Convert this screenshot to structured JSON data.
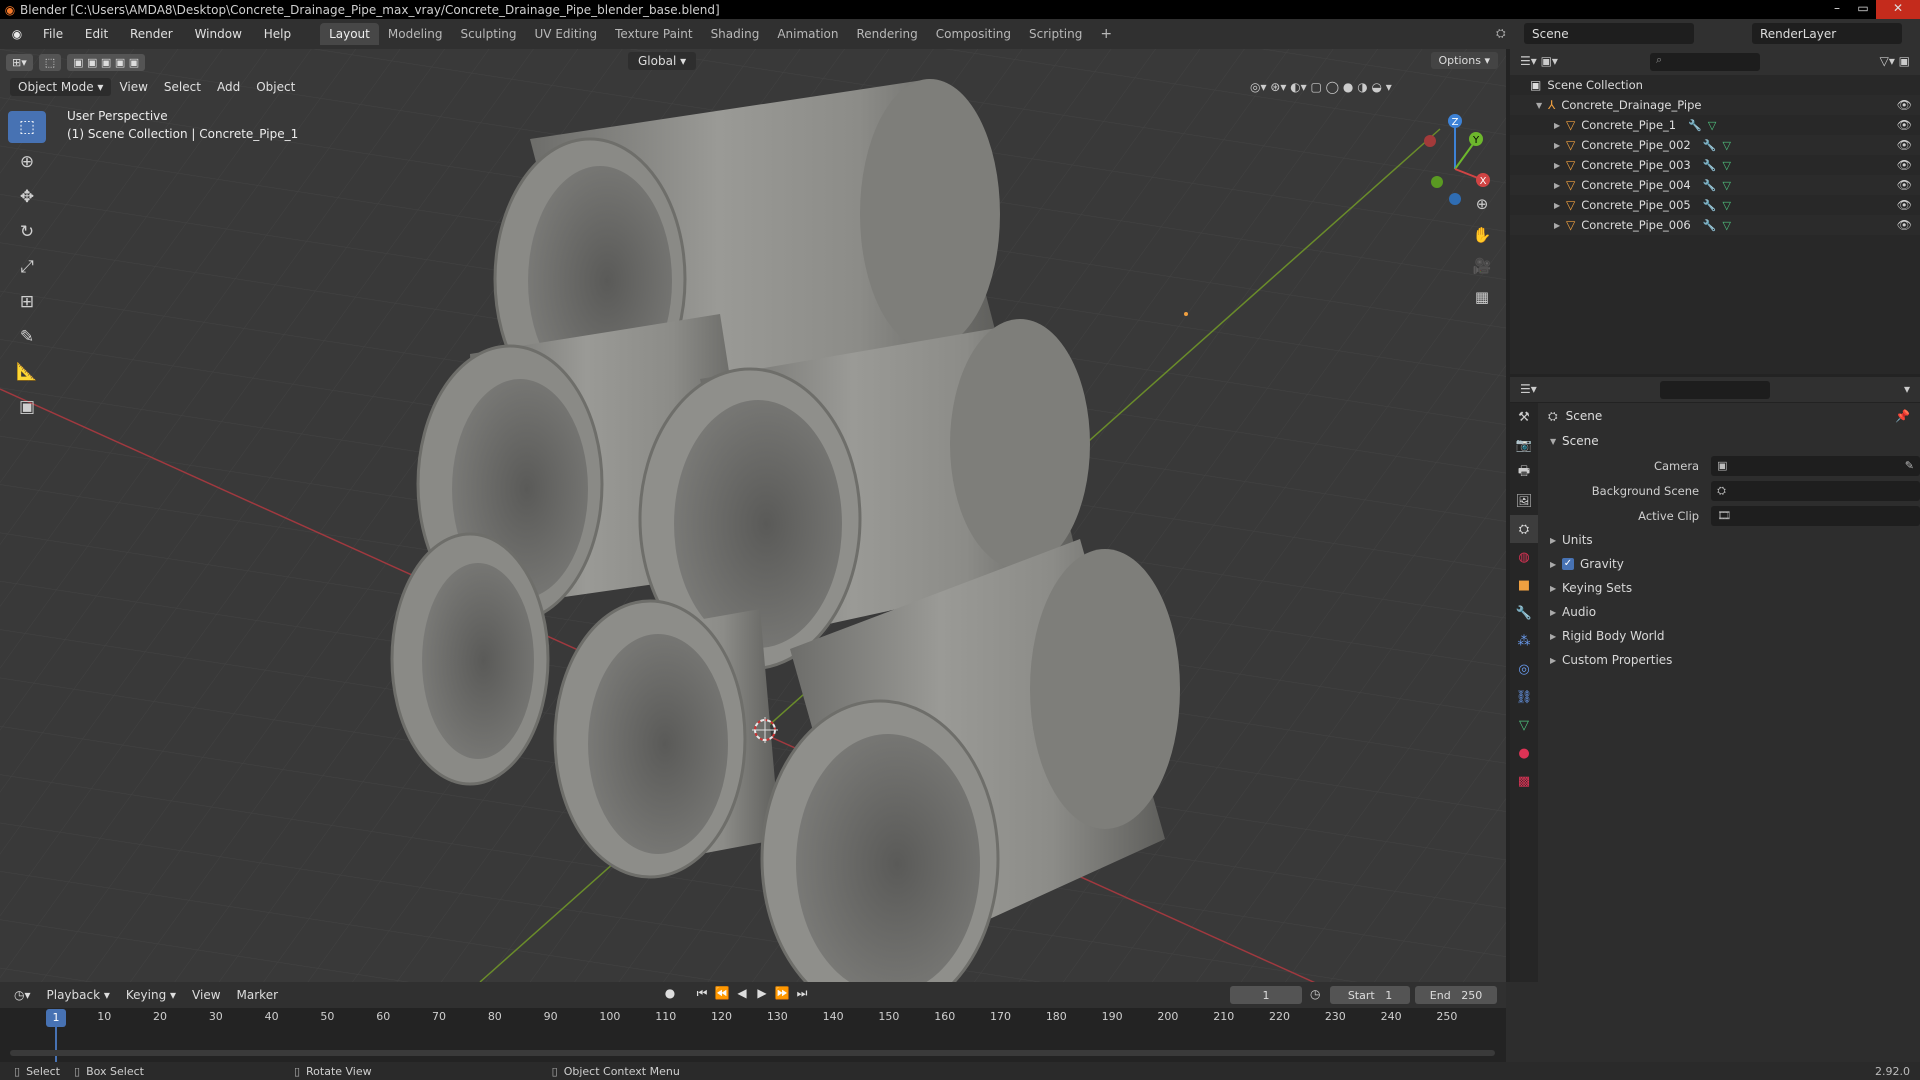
{
  "window": {
    "title": "Blender [C:\\Users\\AMDA8\\Desktop\\Concrete_Drainage_Pipe_max_vray/Concrete_Drainage_Pipe_blender_base.blend]"
  },
  "menu": [
    "File",
    "Edit",
    "Render",
    "Window",
    "Help"
  ],
  "workspaces": [
    "Layout",
    "Modeling",
    "Sculpting",
    "UV Editing",
    "Texture Paint",
    "Shading",
    "Animation",
    "Rendering",
    "Compositing",
    "Scripting"
  ],
  "active_workspace": "Layout",
  "scene_name": "Scene",
  "render_layer": "RenderLayer",
  "viewport": {
    "mode": "Object Mode",
    "menus": [
      "View",
      "Select",
      "Add",
      "Object"
    ],
    "orientation": "Global",
    "options_label": "Options",
    "perspective_label": "User Perspective",
    "collection_label": "(1) Scene Collection | Concrete_Pipe_1",
    "gizmo": {
      "z": "Z",
      "y": "Y",
      "x": "X"
    }
  },
  "outliner": {
    "root": "Scene Collection",
    "collection": "Concrete_Drainage_Pipe",
    "objects": [
      "Concrete_Pipe_1",
      "Concrete_Pipe_002",
      "Concrete_Pipe_003",
      "Concrete_Pipe_004",
      "Concrete_Pipe_005",
      "Concrete_Pipe_006"
    ]
  },
  "properties": {
    "header": "Scene",
    "panel": "Scene",
    "fields": {
      "camera": "Camera",
      "background_scene": "Background Scene",
      "active_clip": "Active Clip"
    },
    "collapsed": {
      "units": "Units",
      "gravity": "Gravity",
      "keying_sets": "Keying Sets",
      "audio": "Audio",
      "rigid_body_world": "Rigid Body World",
      "custom_properties": "Custom Properties"
    },
    "gravity_checked": true
  },
  "timeline": {
    "menus": [
      "Playback",
      "Keying",
      "View",
      "Marker"
    ],
    "current_frame": "1",
    "start_label": "Start",
    "start": "1",
    "end_label": "End",
    "end": "250",
    "ticks": [
      "1",
      "10",
      "20",
      "30",
      "40",
      "50",
      "60",
      "70",
      "80",
      "90",
      "100",
      "110",
      "120",
      "130",
      "140",
      "150",
      "160",
      "170",
      "180",
      "190",
      "200",
      "210",
      "220",
      "230",
      "240",
      "250"
    ]
  },
  "statusbar": {
    "select": "Select",
    "box_select": "Box Select",
    "rotate_view": "Rotate View",
    "context_menu": "Object Context Menu",
    "version": "2.92.0"
  },
  "colors": {
    "accent": "#4772b3",
    "object_icon": "#f0a040",
    "mesh_icon": "#4fc37e",
    "x_axis": "#d04444",
    "y_axis": "#6db82c",
    "z_axis": "#3d82d6"
  }
}
